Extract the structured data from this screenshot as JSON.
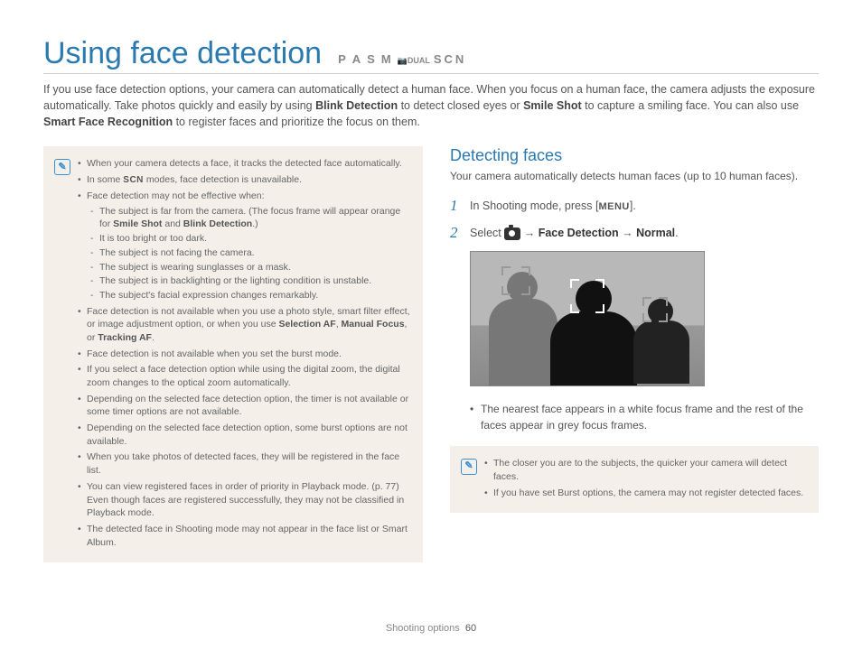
{
  "title": "Using face detection",
  "mode_row": {
    "p": "P",
    "a": "A",
    "s": "S",
    "m": "M",
    "dual": "DUAL",
    "scn": "SCN"
  },
  "intro_parts": {
    "t1": "If you use face detection options, your camera can automatically detect a human face. When you focus on a human face, the camera adjusts the exposure automatically. Take photos quickly and easily by using ",
    "b1": "Blink Detection",
    "t2": " to detect closed eyes or ",
    "b2": "Smile Shot",
    "t3": " to capture a smiling face. You can also use ",
    "b3": "Smart Face Recognition",
    "t4": " to register faces and prioritize the focus on them."
  },
  "left_notes": {
    "n1": "When your camera detects a face, it tracks the detected face automatically.",
    "n2a": "In some ",
    "n2scn": "SCN",
    "n2b": " modes, face detection is unavailable.",
    "n3": "Face detection may not be effective when:",
    "n3s1a": "The subject is far from the camera. (The focus frame will appear orange for ",
    "n3s1b1": "Smile Shot",
    "n3s1mid": " and ",
    "n3s1b2": "Blink Detection",
    "n3s1end": ".)",
    "n3s2": "It is too bright or too dark.",
    "n3s3": "The subject is not facing the camera.",
    "n3s4": "The subject is wearing sunglasses or a mask.",
    "n3s5": "The subject is in backlighting or the lighting condition is unstable.",
    "n3s6": "The subject's facial expression changes remarkably.",
    "n4a": "Face detection is not available when you use a photo style, smart filter effect, or image adjustment option, or when you use ",
    "n4b1": "Selection AF",
    "n4c1": ", ",
    "n4b2": "Manual Focus",
    "n4c2": ", or ",
    "n4b3": "Tracking AF",
    "n4end": ".",
    "n5": "Face detection is not available when you set the burst mode.",
    "n6": "If you select a face detection option while using the digital zoom, the digital zoom changes to the optical zoom automatically.",
    "n7": "Depending on the selected face detection option, the timer is not available or some timer options are not available.",
    "n8": "Depending on the selected face detection option, some burst options are not available.",
    "n9": "When you take photos of detected faces, they will be registered in the face list.",
    "n10": "You can view registered faces in order of priority in Playback mode. (p. 77) Even though faces are registered successfully, they may not be classified in Playback mode.",
    "n11": "The detected face in Shooting mode may not appear in the face list or Smart Album."
  },
  "right": {
    "heading": "Detecting faces",
    "sub": "Your camera automatically detects human faces (up to 10 human faces).",
    "step1a": "In Shooting mode, press [",
    "step1menu": "MENU",
    "step1b": "].",
    "step2a": "Select ",
    "step2fd": "Face Detection",
    "step2norm": "Normal",
    "step2dot": ".",
    "result": "The nearest face appears in a white focus frame and the rest of the faces appear in grey focus frames.",
    "tip1": "The closer you are to the subjects, the quicker your camera will detect faces.",
    "tip2": "If you have set Burst options, the camera may not register detected faces."
  },
  "footer": {
    "section": "Shooting options",
    "page": "60"
  }
}
